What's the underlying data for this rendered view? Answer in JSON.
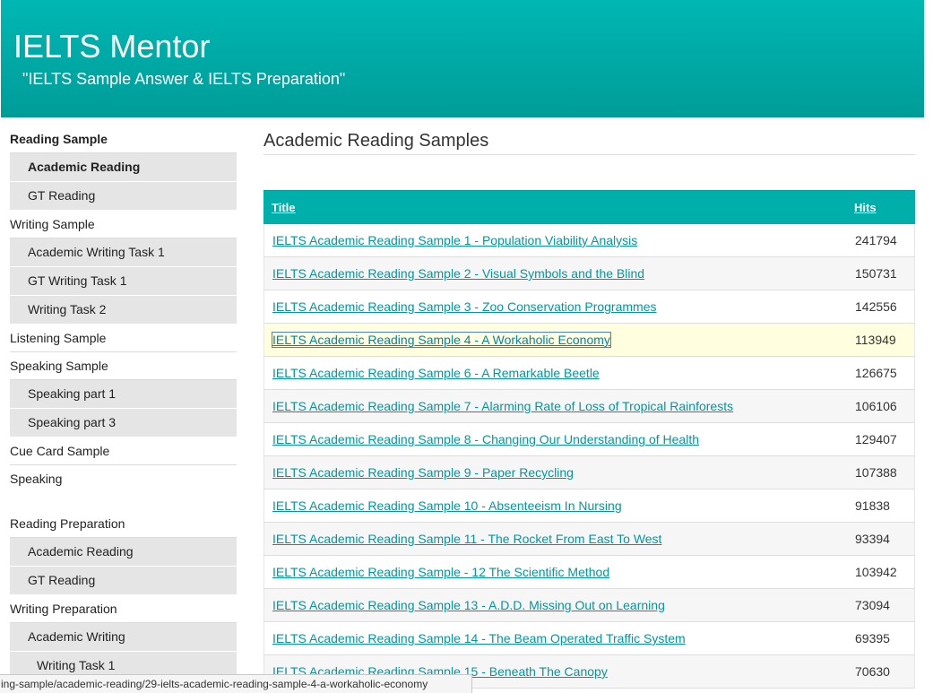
{
  "header": {
    "title": "IELTS Mentor",
    "tagline": "\"IELTS Sample Answer & IELTS Preparation\""
  },
  "sidebar": {
    "items": [
      {
        "label": "Reading Sample",
        "level": "top",
        "bold": true
      },
      {
        "label": "Academic Reading",
        "level": "sub",
        "bold": true
      },
      {
        "label": "GT Reading",
        "level": "sub"
      },
      {
        "label": "Writing Sample",
        "level": "top"
      },
      {
        "label": "Academic Writing Task 1",
        "level": "sub"
      },
      {
        "label": "GT Writing Task 1",
        "level": "sub"
      },
      {
        "label": "Writing Task 2",
        "level": "sub"
      },
      {
        "label": "Listening Sample",
        "level": "top"
      },
      {
        "label": "Speaking Sample",
        "level": "top"
      },
      {
        "label": "Speaking part 1",
        "level": "sub"
      },
      {
        "label": "Speaking part 3",
        "level": "sub"
      },
      {
        "label": "Cue Card Sample",
        "level": "top"
      },
      {
        "label": "Speaking",
        "level": "top"
      },
      {
        "label": "Reading Preparation",
        "level": "top"
      },
      {
        "label": "Academic Reading",
        "level": "sub"
      },
      {
        "label": "GT Reading",
        "level": "sub"
      },
      {
        "label": "Writing Preparation",
        "level": "top"
      },
      {
        "label": "Academic Writing",
        "level": "sub"
      },
      {
        "label": "Writing Task 1",
        "level": "sub2"
      }
    ]
  },
  "main": {
    "heading": "Academic Reading Samples",
    "table": {
      "col_title": "Title",
      "col_hits": "Hits",
      "rows": [
        {
          "title": "IELTS Academic Reading Sample 1 - Population Viability Analysis",
          "hits": "241794"
        },
        {
          "title": "IELTS Academic Reading Sample 2 - Visual Symbols and the Blind",
          "hits": "150731"
        },
        {
          "title": "IELTS Academic Reading Sample 3 - Zoo Conservation Programmes",
          "hits": "142556"
        },
        {
          "title": "IELTS Academic Reading Sample 4 - A Workaholic Economy",
          "hits": "113949",
          "highlighted": true
        },
        {
          "title": "IELTS Academic Reading Sample 6 - A Remarkable Beetle",
          "hits": "126675"
        },
        {
          "title": "IELTS Academic Reading Sample 7 - Alarming Rate of Loss of Tropical Rainforests",
          "hits": "106106"
        },
        {
          "title": "IELTS Academic Reading Sample 8 - Changing Our Understanding of Health",
          "hits": "129407"
        },
        {
          "title": "IELTS Academic Reading Sample 9 - Paper Recycling",
          "hits": "107388"
        },
        {
          "title": "IELTS Academic Reading Sample 10 - Absenteeism In Nursing",
          "hits": "91838"
        },
        {
          "title": "IELTS Academic Reading Sample 11 - The Rocket From East To West",
          "hits": "93394"
        },
        {
          "title": "IELTS Academic Reading Sample - 12 The Scientific Method",
          "hits": "103942"
        },
        {
          "title": "IELTS Academic Reading Sample 13 - A.D.D. Missing Out on Learning",
          "hits": "73094"
        },
        {
          "title": "IELTS Academic Reading Sample 14 - The Beam Operated Traffic System",
          "hits": "69395"
        },
        {
          "title": "IELTS Academic Reading Sample 15 - Beneath The Canopy",
          "hits": "70630"
        }
      ]
    }
  },
  "statusbar": {
    "url": "ing-sample/academic-reading/29-ielts-academic-reading-sample-4-a-workaholic-economy"
  },
  "colors": {
    "header_teal": "#00aeaa",
    "link": "#0097a1",
    "highlight_row": "#ffffe0",
    "nav_sub_bg": "#e5e5e5"
  }
}
